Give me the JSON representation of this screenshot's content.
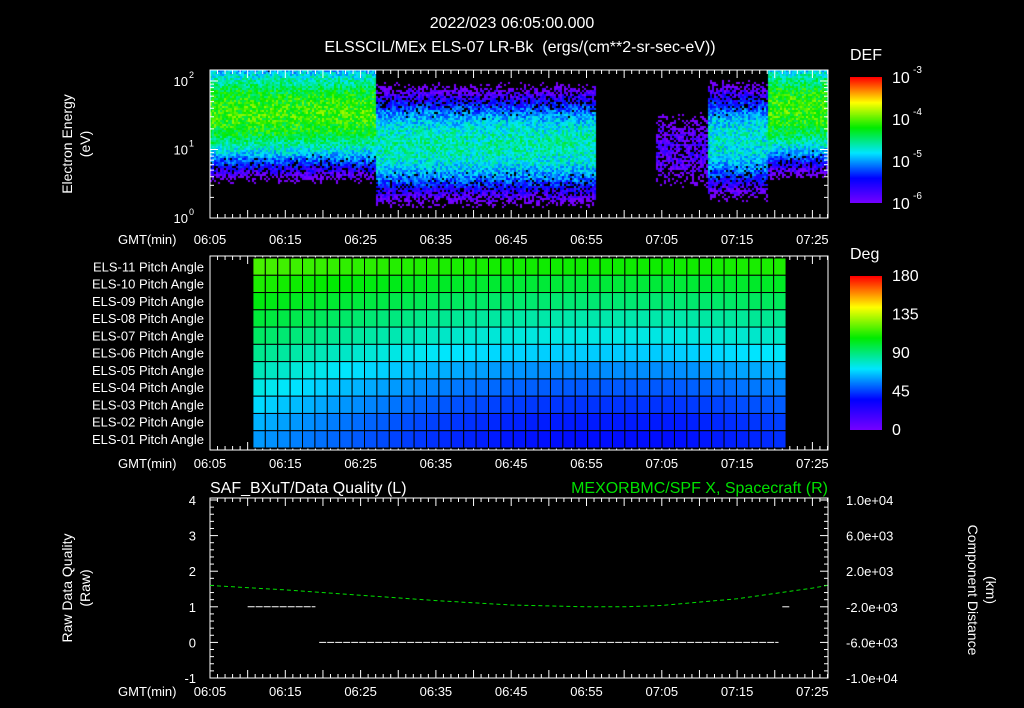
{
  "header": {
    "datetime": "2022/023 06:05:00.000"
  },
  "chart_data": [
    {
      "type": "heatmap",
      "title": "ELSSCIL/MEx ELS-07 LR-Bk  (ergs/(cm**2-sr-sec-eV))",
      "ylabel": [
        "Electron Energy",
        "(eV)"
      ],
      "xlabel": "GMT(min)",
      "x_ticks": [
        "06:05",
        "06:15",
        "06:25",
        "06:35",
        "06:45",
        "06:55",
        "07:05",
        "07:15",
        "07:25"
      ],
      "x_range_min": [
        0,
        82
      ],
      "y_scale": "log",
      "y_ticks": [
        {
          "base": "10",
          "exp": "0"
        },
        {
          "base": "10",
          "exp": "1"
        },
        {
          "base": "10",
          "exp": "2"
        }
      ],
      "y_range_eV": [
        1,
        145
      ],
      "colorbar": {
        "label": "DEF",
        "scale": "log",
        "range": [
          1e-06,
          0.001
        ],
        "ticks": [
          {
            "base": "10",
            "exp": "-3"
          },
          {
            "base": "10",
            "exp": "-4"
          },
          {
            "base": "10",
            "exp": "-5"
          },
          {
            "base": "10",
            "exp": "-6"
          }
        ]
      },
      "regions": [
        {
          "t": [
            0,
            22
          ],
          "peak_eV": 35,
          "peak_log_def": -4.1
        },
        {
          "t": [
            22,
            51
          ],
          "peak_eV": 12,
          "peak_log_def": -4.6
        },
        {
          "t": [
            51,
            59
          ],
          "peak_eV": 0,
          "peak_log_def": -7
        },
        {
          "t": [
            59,
            66
          ],
          "peak_eV": 10,
          "peak_log_def": -5.8
        },
        {
          "t": [
            66,
            74
          ],
          "peak_eV": 14,
          "peak_log_def": -4.7
        },
        {
          "t": [
            74,
            82
          ],
          "peak_eV": 40,
          "peak_log_def": -4.1
        }
      ]
    },
    {
      "type": "heatmap",
      "xlabel": "GMT(min)",
      "x_ticks": [
        "06:05",
        "06:15",
        "06:25",
        "06:35",
        "06:45",
        "06:55",
        "07:05",
        "07:15",
        "07:25"
      ],
      "rows": [
        "ELS-11 Pitch Angle",
        "ELS-10 Pitch Angle",
        "ELS-09 Pitch Angle",
        "ELS-08 Pitch Angle",
        "ELS-07 Pitch Angle",
        "ELS-06 Pitch Angle",
        "ELS-05 Pitch Angle",
        "ELS-04 Pitch Angle",
        "ELS-03 Pitch Angle",
        "ELS-02 Pitch Angle",
        "ELS-01 Pitch Angle"
      ],
      "data_time_range_min": [
        5.7,
        76.5
      ],
      "columns": 43,
      "row_pitch_deg_start": [
        118,
        112,
        106,
        100,
        94,
        88,
        82,
        76,
        70,
        64,
        60
      ],
      "row_pitch_deg_middle": [
        110,
        100,
        92,
        84,
        76,
        68,
        58,
        50,
        44,
        40,
        38
      ],
      "colorbar": {
        "label": "Deg",
        "range": [
          0,
          180
        ],
        "ticks": [
          "180",
          "135",
          "90",
          "45",
          "0"
        ]
      }
    },
    {
      "type": "line",
      "title_left": "SAF_BXuT/Data Quality (L)",
      "title_right": "MEXORBMC/SPF X, Spacecraft (R)",
      "ylabel_left": [
        "Raw Data Quality",
        "(Raw)"
      ],
      "ylabel_right": [
        "Component Distance",
        "(km)"
      ],
      "xlabel": "GMT(min)",
      "x_ticks": [
        "06:05",
        "06:15",
        "06:25",
        "06:35",
        "06:45",
        "06:55",
        "07:05",
        "07:15",
        "07:25"
      ],
      "ylim_left": [
        -1,
        4
      ],
      "y_ticks_left": [
        "4",
        "3",
        "2",
        "1",
        "0",
        "-1"
      ],
      "ylim_right": [
        -10000,
        10000
      ],
      "y_ticks_right": [
        "1.0e+04",
        "6.0e+03",
        "2.0e+03",
        "-2.0e+03",
        "-6.0e+03",
        "-1.0e+04"
      ],
      "series": [
        {
          "name": "Data Quality",
          "color": "#ffffff",
          "segments": [
            {
              "t": [
                5,
                14
              ],
              "value": 1
            },
            {
              "t": [
                14.5,
                75.5
              ],
              "value": 0
            },
            {
              "t": [
                76,
                77
              ],
              "value": 1
            }
          ]
        },
        {
          "name": "SPF X",
          "color": "#00e000",
          "t_min": [
            0,
            10,
            20,
            30,
            40,
            50,
            55,
            60,
            70,
            80,
            82
          ],
          "values_km": [
            400,
            -100,
            -700,
            -1300,
            -1800,
            -2000,
            -2000,
            -1850,
            -1100,
            100,
            400
          ]
        }
      ]
    }
  ]
}
